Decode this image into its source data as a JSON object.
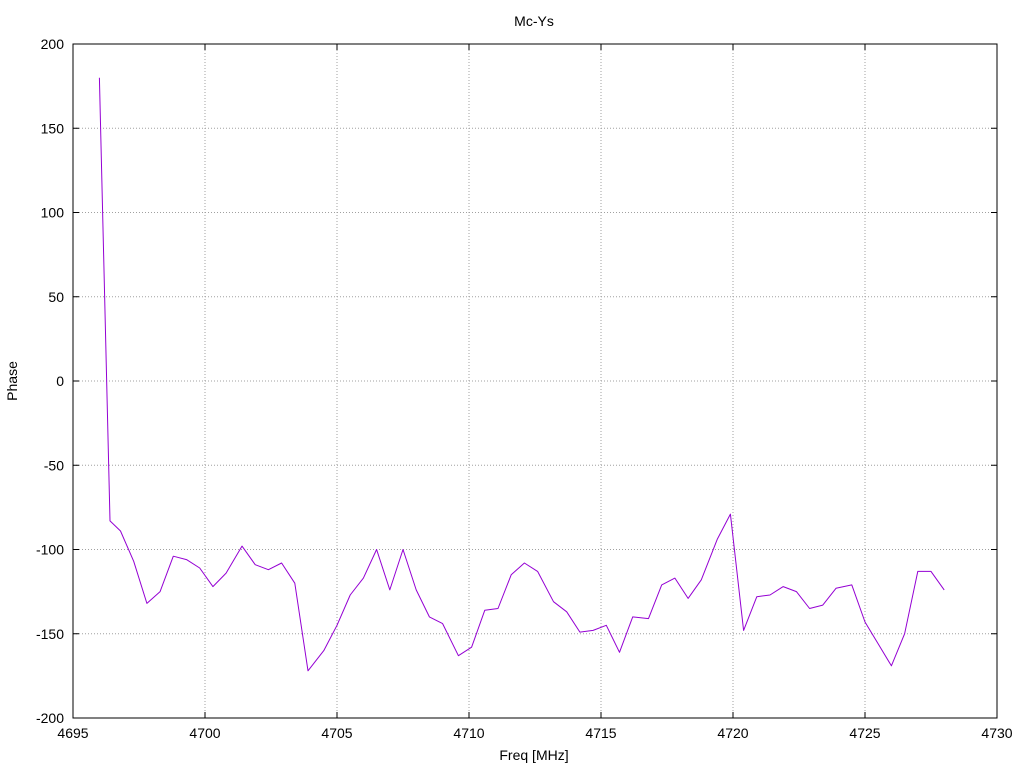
{
  "chart_data": {
    "type": "line",
    "title": "Mc-Ys",
    "xlabel": "Freq [MHz]",
    "ylabel": "Phase",
    "xlim": [
      4695,
      4730
    ],
    "ylim": [
      -200,
      200
    ],
    "xticks": [
      4695,
      4700,
      4705,
      4710,
      4715,
      4720,
      4725,
      4730
    ],
    "yticks": [
      -200,
      -150,
      -100,
      -50,
      0,
      50,
      100,
      150,
      200
    ],
    "grid": true,
    "legend": "none",
    "series": [
      {
        "color": "#9400d3",
        "x": [
          4696.0,
          4696.4,
          4696.8,
          4697.3,
          4697.8,
          4698.3,
          4698.8,
          4699.3,
          4699.8,
          4700.3,
          4700.8,
          4701.4,
          4701.9,
          4702.4,
          4702.9,
          4703.4,
          4703.9,
          4704.5,
          4705.0,
          4705.5,
          4706.0,
          4706.5,
          4707.0,
          4707.5,
          4708.0,
          4708.5,
          4709.0,
          4709.6,
          4710.1,
          4710.6,
          4711.1,
          4711.6,
          4712.1,
          4712.6,
          4713.2,
          4713.7,
          4714.2,
          4714.7,
          4715.2,
          4715.7,
          4716.2,
          4716.8,
          4717.3,
          4717.8,
          4718.3,
          4718.8,
          4719.4,
          4719.9,
          4720.4,
          4720.9,
          4721.4,
          4721.9,
          4722.4,
          4722.9,
          4723.4,
          4723.9,
          4724.5,
          4725.0,
          4725.5,
          4726.0,
          4726.5,
          4727.0,
          4727.5,
          4728.0
        ],
        "y": [
          180,
          -83,
          -89,
          -107,
          -132,
          -125,
          -104,
          -106,
          -111,
          -122,
          -114,
          -98,
          -109,
          -112,
          -108,
          -120,
          -172,
          -160,
          -145,
          -127,
          -117,
          -100,
          -124,
          -100,
          -124,
          -140,
          -144,
          -163,
          -158,
          -136,
          -135,
          -115,
          -108,
          -113,
          -131,
          -137,
          -149,
          -148,
          -145,
          -161,
          -140,
          -141,
          -121,
          -117,
          -129,
          -118,
          -94,
          -79,
          -148,
          -128,
          -127,
          -122,
          -125,
          -135,
          -133,
          -123,
          -121,
          -143,
          -156,
          -169,
          -150,
          -113,
          -113,
          -124
        ]
      }
    ]
  }
}
